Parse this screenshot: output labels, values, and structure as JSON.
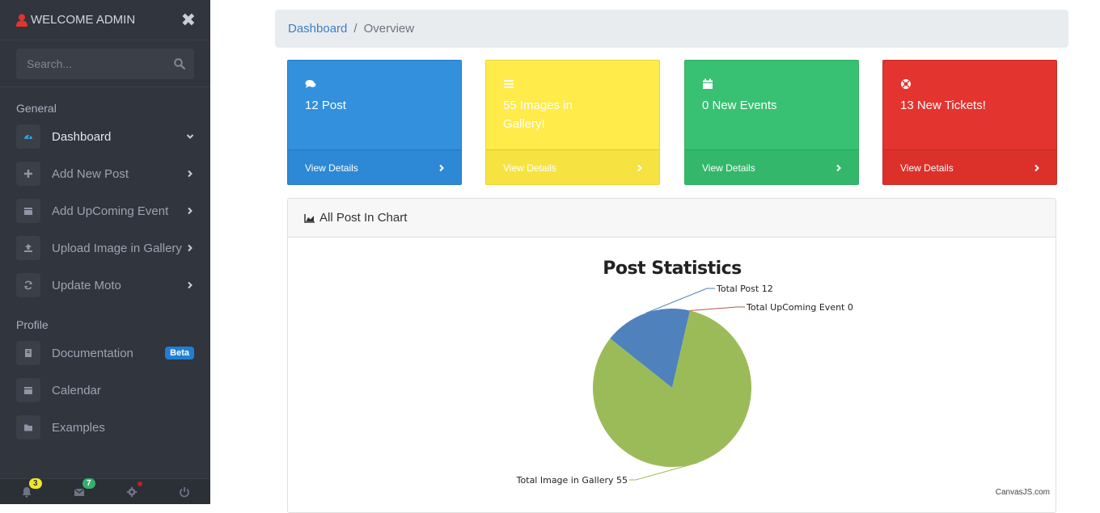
{
  "sidebar": {
    "header_title": "WELCOME ADMIN",
    "search_placeholder": "Search...",
    "sections": {
      "general": "General",
      "profile": "Profile"
    },
    "items": [
      {
        "label": "Dashboard",
        "icon": "dashboard-icon",
        "active": true
      },
      {
        "label": "Add New Post",
        "icon": "plus-icon"
      },
      {
        "label": "Add UpComing Event",
        "icon": "calendar-icon"
      },
      {
        "label": "Upload Image in Gallery",
        "icon": "upload-icon"
      },
      {
        "label": "Update Moto",
        "icon": "refresh-icon"
      },
      {
        "label": "Documentation",
        "icon": "book-icon",
        "badge": "Beta"
      },
      {
        "label": "Calendar",
        "icon": "calendar-icon"
      },
      {
        "label": "Examples",
        "icon": "folder-icon"
      }
    ],
    "footer": {
      "notifications": "3",
      "messages": "7"
    }
  },
  "breadcrumb": {
    "link": "Dashboard",
    "separator": "/",
    "current": "Overview"
  },
  "cards": [
    {
      "text": "12 Post",
      "footer": "View Details",
      "color": "#3290dc",
      "icon": "comments-icon"
    },
    {
      "text": "55 Images in Gallery!",
      "footer": "View Details",
      "color": "#ffeb4a",
      "icon": "list-icon"
    },
    {
      "text": "0 New Events",
      "footer": "View Details",
      "color": "#38c172",
      "icon": "calendar-icon"
    },
    {
      "text": "13 New Tickets!",
      "footer": "View Details",
      "color": "#e3342f",
      "icon": "life-ring-icon"
    }
  ],
  "chart_panel": {
    "title": "All Post In Chart",
    "credit": "CanvasJS.com"
  },
  "chart_data": {
    "type": "pie",
    "title": "Post Statistics",
    "slices": [
      {
        "label": "Total Post",
        "value": 12,
        "color": "#4f81bc"
      },
      {
        "label": "Total UpComing Event",
        "value": 0,
        "color": "#c0504e"
      },
      {
        "label": "Total Image in Gallery",
        "value": 55,
        "color": "#9bbb58"
      }
    ]
  }
}
